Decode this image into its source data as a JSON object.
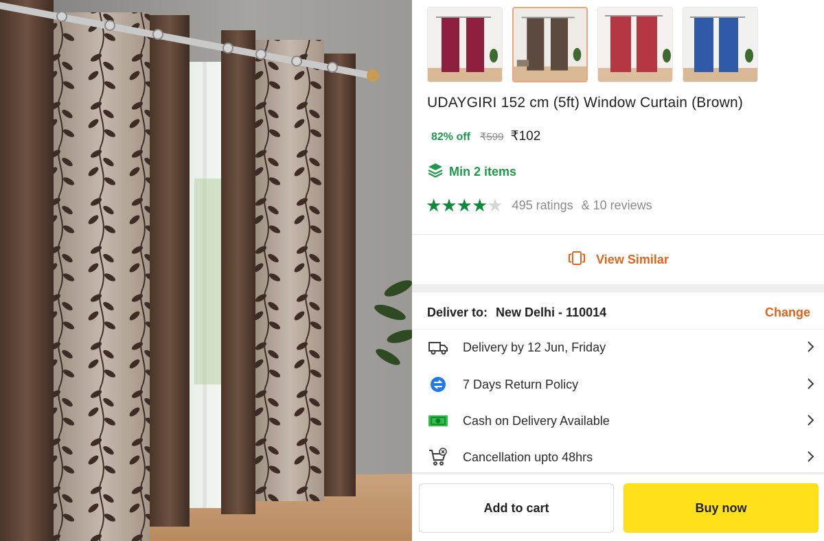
{
  "product": {
    "title": "UDAYGIRI 152 cm (5ft) Window Curtain (Brown)",
    "discount": "82% off",
    "mrp": "₹599",
    "price": "₹102",
    "min_items": "Min 2 items",
    "rating": 4,
    "rating_max": 5,
    "ratings_text": "495 ratings",
    "reviews_text": "& 10 reviews"
  },
  "thumbnails": [
    {
      "color": "maroon",
      "curtain_hex": "#8f1f3f",
      "selected": false
    },
    {
      "color": "brown",
      "curtain_hex": "#5c4a3e",
      "selected": true
    },
    {
      "color": "red",
      "curtain_hex": "#b63744",
      "selected": false
    },
    {
      "color": "blue",
      "curtain_hex": "#2f5aa8",
      "selected": false
    }
  ],
  "actions": {
    "view_similar": "View Similar",
    "add_to_cart": "Add to cart",
    "buy_now": "Buy now"
  },
  "delivery": {
    "label": "Deliver to:",
    "location": "New Delhi - 110014",
    "change": "Change",
    "items": [
      {
        "icon": "truck-icon",
        "text": "Delivery by 12 Jun, Friday"
      },
      {
        "icon": "return-arrows-icon",
        "text": "7 Days Return Policy"
      },
      {
        "icon": "cash-icon",
        "text": "Cash on Delivery Available"
      },
      {
        "icon": "cart-cancel-icon",
        "text": "Cancellation upto 48hrs"
      }
    ]
  },
  "colors": {
    "green": "#1b9b4a",
    "star_green": "#0f8a3b",
    "orange": "#e0641b",
    "buy_yellow": "#ffe11b",
    "selected_border": "#f3a37b"
  }
}
